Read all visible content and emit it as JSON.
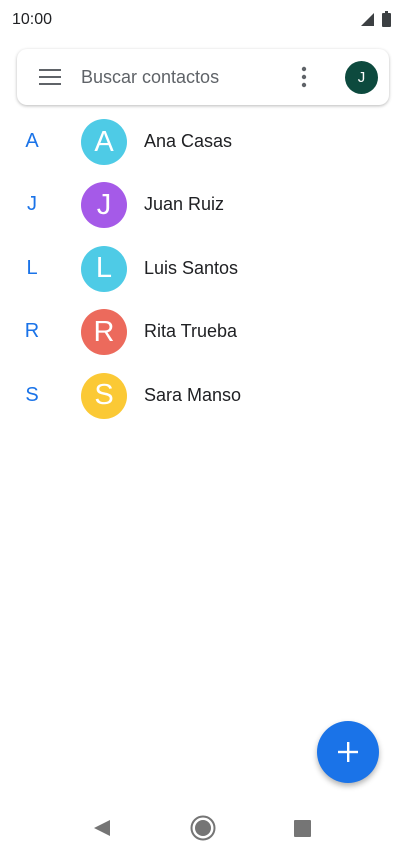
{
  "status_bar": {
    "time": "10:00",
    "signal_icon": "signal-icon",
    "battery_icon": "battery-icon"
  },
  "search": {
    "menu_icon": "menu-icon",
    "value": "",
    "placeholder": "Buscar contactos",
    "more_icon": "more-vert-icon",
    "account_initial": "J",
    "account_color": "#0d4a3e"
  },
  "contacts": [
    {
      "section": "A",
      "initial": "A",
      "name": "Ana Casas",
      "color": "#4ecbe6"
    },
    {
      "section": "J",
      "initial": "J",
      "name": "Juan Ruiz",
      "color": "#a55ae8"
    },
    {
      "section": "L",
      "initial": "L",
      "name": "Luis Santos",
      "color": "#4ecbe6"
    },
    {
      "section": "R",
      "initial": "R",
      "name": "Rita Trueba",
      "color": "#ec6a5c"
    },
    {
      "section": "S",
      "initial": "S",
      "name": "Sara Manso",
      "color": "#fbc935"
    }
  ],
  "fab": {
    "icon": "plus-icon",
    "color": "#1a73e8"
  },
  "nav_bar": {
    "back_icon": "back-triangle-icon",
    "home_icon": "home-circle-icon",
    "recents_icon": "recents-square-icon"
  },
  "colors": {
    "accent": "#1a73e8",
    "text_primary": "#202124",
    "text_secondary": "#5f6368"
  }
}
